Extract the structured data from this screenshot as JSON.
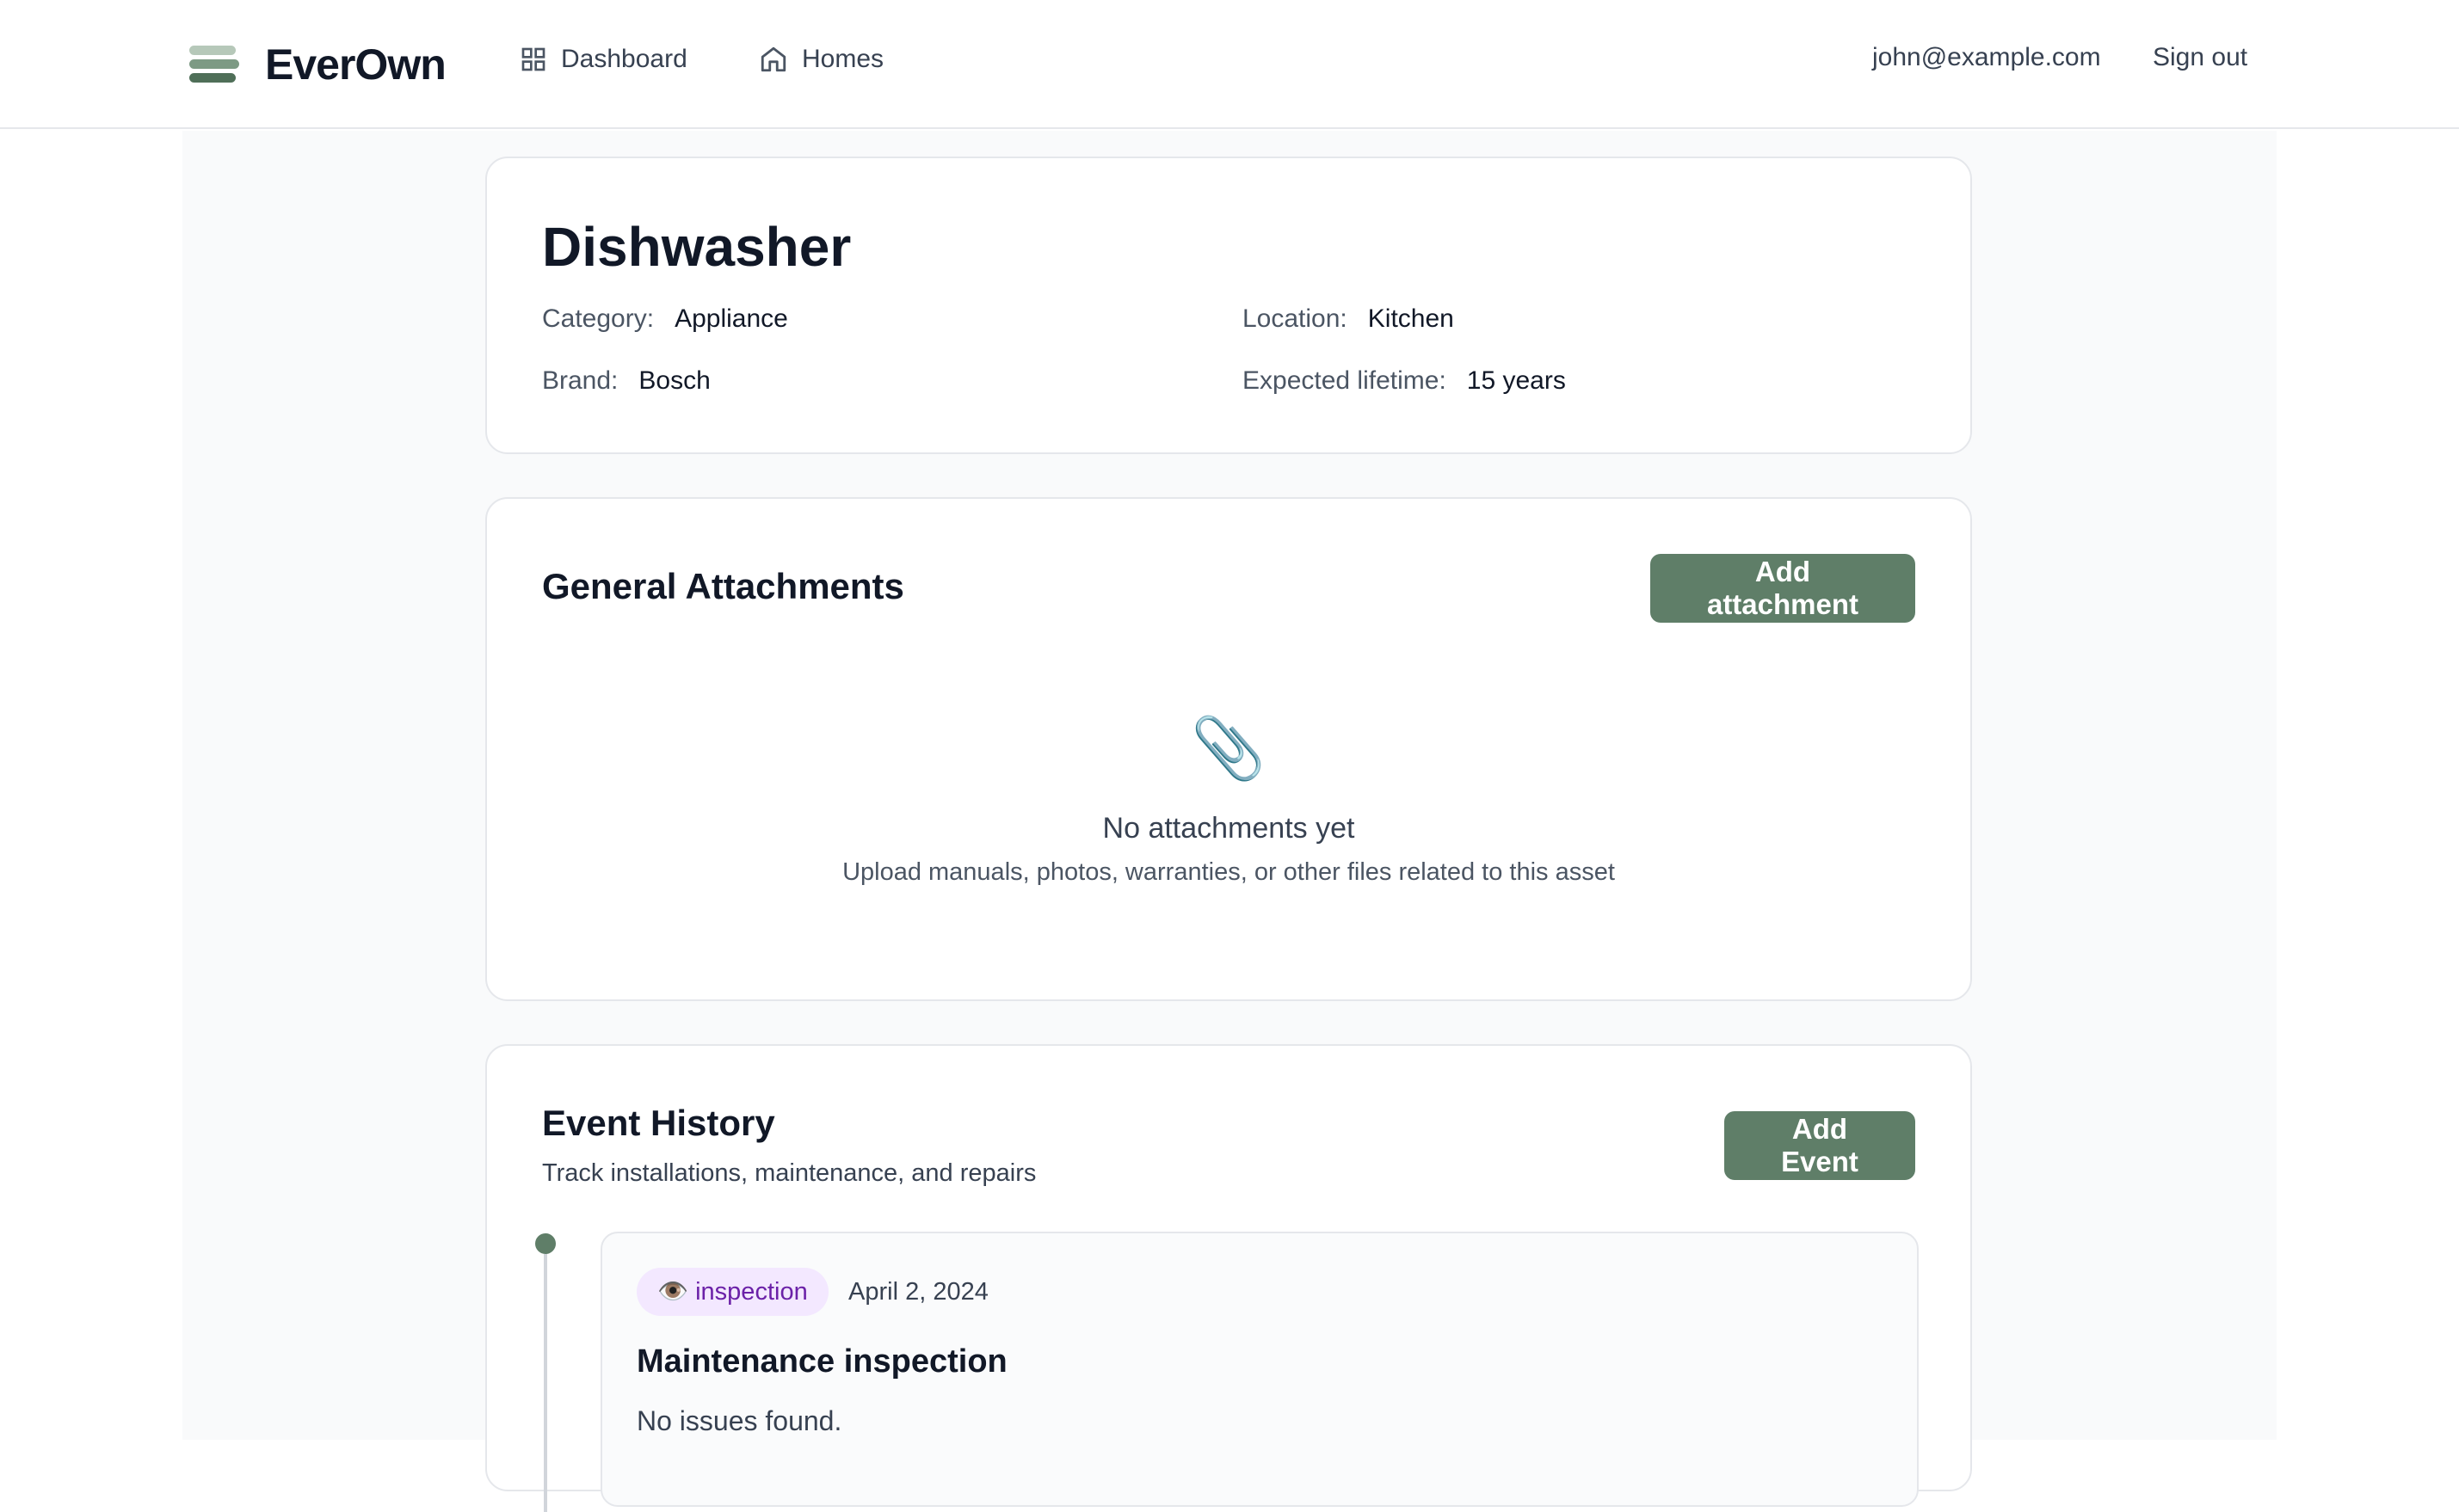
{
  "app": {
    "name": "EverOwn"
  },
  "nav": {
    "dashboard": "Dashboard",
    "homes": "Homes"
  },
  "user": {
    "email": "john@example.com",
    "sign_out": "Sign out"
  },
  "asset": {
    "name": "Dishwasher",
    "category_label": "Category:",
    "category": "Appliance",
    "brand_label": "Brand:",
    "brand": "Bosch",
    "location_label": "Location:",
    "location": "Kitchen",
    "lifetime_label": "Expected lifetime:",
    "lifetime": "15 years"
  },
  "attachments": {
    "title": "General Attachments",
    "add_label": "Add attachment",
    "empty_icon": "📎",
    "empty_title": "No attachments yet",
    "empty_desc": "Upload manuals, photos, warranties, or other files related to this asset"
  },
  "events": {
    "title": "Event History",
    "subtitle": "Track installations, maintenance, and repairs",
    "add_label": "Add Event",
    "items": [
      {
        "type_icon": "👁️",
        "type": "inspection",
        "date": "April 2, 2024",
        "title": "Maintenance inspection",
        "description": "No issues found."
      }
    ]
  },
  "colors": {
    "accent": "#5f7e68",
    "badge_bg": "#f3e8ff",
    "badge_text": "#6b21a8"
  }
}
